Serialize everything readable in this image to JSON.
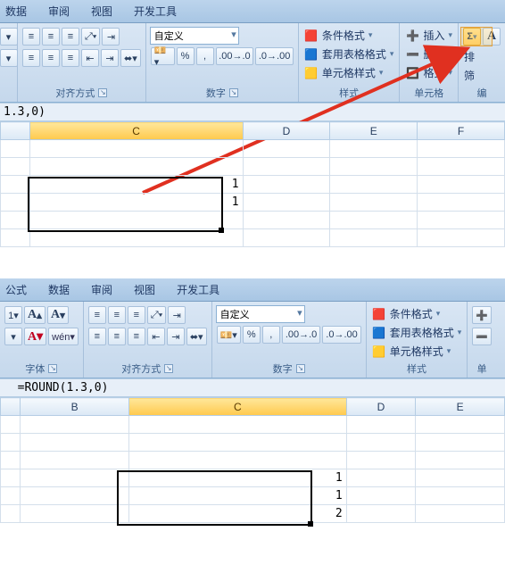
{
  "top": {
    "tabs": {
      "data": "数据",
      "review": "审阅",
      "view": "视图",
      "dev": "开发工具"
    },
    "groups": {
      "align": {
        "label": "对齐方式",
        "wrap_dd": "▾",
        "icons": [
          "align-top",
          "align-mid",
          "align-bot",
          "orient",
          "wrap",
          "merge"
        ]
      },
      "number": {
        "label": "数字",
        "format": "自定义",
        "btns": {
          "currency": "¥",
          "percent": "%",
          "comma": ",",
          "inc": ".0→",
          "dec": "→.0"
        }
      },
      "styles": {
        "label": "样式",
        "cond": "条件格式",
        "table": "套用表格格式",
        "cell": "单元格样式"
      },
      "cells": {
        "label": "单元格",
        "insert": "插入",
        "delete": "删除",
        "format": "格式"
      },
      "edit": {
        "label": "编",
        "sum": "Σ",
        "sort": "排",
        "filter": "筛"
      }
    },
    "formula": "1.3,0)",
    "grid": {
      "cols": [
        "C",
        "D",
        "E",
        "F"
      ],
      "selCol": "C",
      "cells": {
        "r1": "1",
        "r2": "1"
      }
    }
  },
  "bottom": {
    "tabs": {
      "formula": "公式",
      "data": "数据",
      "review": "审阅",
      "view": "视图",
      "dev": "开发工具"
    },
    "groups": {
      "font": {
        "label": "字体",
        "size_dd": "▾",
        "grow": "A↑",
        "shrink": "A↓",
        "color_A": "A",
        "highlight": "wén"
      },
      "align": {
        "label": "对齐方式"
      },
      "number": {
        "label": "数字",
        "format": "自定义"
      },
      "styles": {
        "label": "样式",
        "cond": "条件格式",
        "table": "套用表格格式",
        "cell": "单元格样式"
      },
      "cells": {
        "label": "单"
      }
    },
    "formula": "=ROUND(1.3,0)",
    "grid": {
      "cols": [
        "B",
        "C",
        "D",
        "E"
      ],
      "selCol": "C",
      "cells": {
        "r1": "1",
        "r2": "1",
        "r3": "2"
      }
    }
  },
  "chart_data": null
}
